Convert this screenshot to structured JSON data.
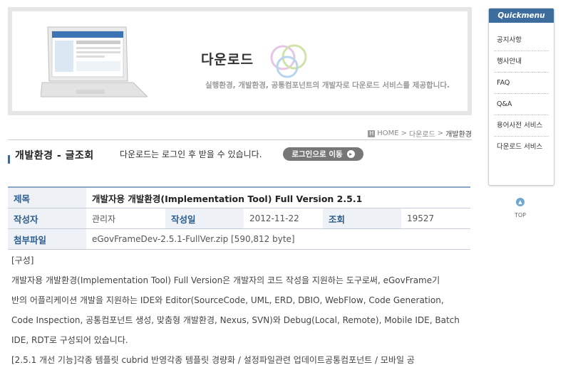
{
  "banner": {
    "title": "다운로드",
    "subtitle": "실행환경, 개발환경, 공통컴포넌트의 개발자로 다운로드 서비스를 제공합니다."
  },
  "breadcrumb": {
    "home": "HOME",
    "items": [
      "다운로드",
      "개발환경"
    ]
  },
  "page": {
    "title": "개발환경 - 글조회",
    "login_note": "다운로드는 로그인 후 받을 수 있습니다.",
    "login_button": "로그인으로 이동"
  },
  "post": {
    "labels": {
      "title": "제목",
      "author": "작성자",
      "date": "작성일",
      "views": "조회",
      "attachment": "첨부파일"
    },
    "title": "개발자용 개발환경(Implementation Tool) Full Version 2.5.1",
    "author": "관리자",
    "date": "2012-11-22",
    "views": "19527",
    "attachment": "eGovFrameDev-2.5.1-FullVer.zip [590,812 byte]"
  },
  "content": {
    "lines": [
      "[구성]",
      "개발자용 개발환경(Implementation Tool) Full Version은 개발자의 코드 작성을 지원하는 도구로써, eGovFrame기",
      "반의 어플리케이션 개발을 지원하는 IDE와 Editor(SourceCode, UML, ERD, DBIO, WebFlow, Code Generation,",
      "Code Inspection, 공통컴포넌트 생성, 맞춤형 개발환경, Nexus, SVN)와 Debug(Local, Remote), Mobile IDE, Batch",
      "IDE, RDT로 구성되어 있습니다.",
      "[2.5.1 개선 기능]각종 템플릿 cubrid 반영각종 템플릿 경량화 / 설정파일관련 업데이트공통컴포넌트 / 모바일 공"
    ]
  },
  "quickmenu": {
    "title": "Quickmenu",
    "items": [
      "공지사항",
      "행사안내",
      "FAQ",
      "Q&A",
      "용어사전 서비스",
      "다운로드 서비스"
    ]
  },
  "top_button": "TOP"
}
